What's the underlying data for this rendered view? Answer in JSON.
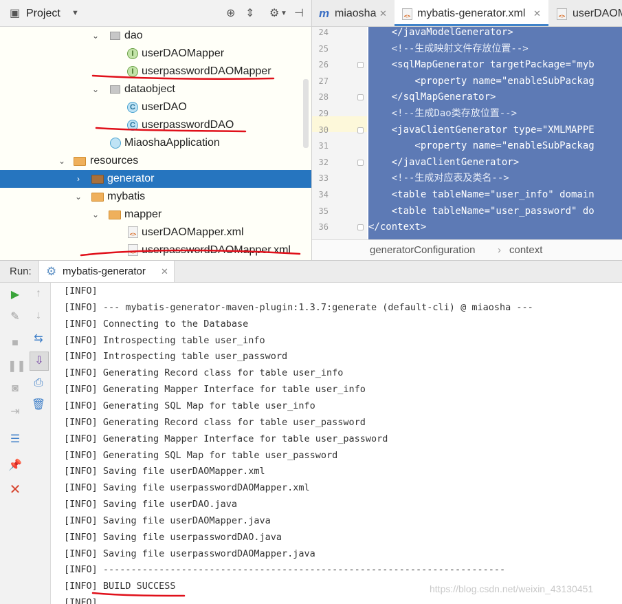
{
  "project": {
    "title": "Project",
    "tree": [
      {
        "label": "dao",
        "type": "package"
      },
      {
        "label": "userDAOMapper",
        "type": "interface"
      },
      {
        "label": "userpasswordDAOMapper",
        "type": "interface"
      },
      {
        "label": "dataobject",
        "type": "package"
      },
      {
        "label": "userDAO",
        "type": "class"
      },
      {
        "label": "userpasswordDAO",
        "type": "class"
      },
      {
        "label": "MiaoshaApplication",
        "type": "app"
      },
      {
        "label": "resources",
        "type": "folder"
      },
      {
        "label": "generator",
        "type": "folder",
        "selected": true
      },
      {
        "label": "mybatis",
        "type": "folder"
      },
      {
        "label": "mapper",
        "type": "folder"
      },
      {
        "label": "userDAOMapper.xml",
        "type": "xml"
      },
      {
        "label": "userpasswordDAOMapper.xml",
        "type": "xml"
      }
    ]
  },
  "editor": {
    "tabs": [
      {
        "label": "miaosha",
        "icon": "module-icon"
      },
      {
        "label": "mybatis-generator.xml",
        "icon": "xml-file-icon",
        "active": true
      },
      {
        "label": "userDAOM",
        "icon": "xml-file-icon"
      }
    ],
    "line_numbers": [
      "24",
      "25",
      "26",
      "27",
      "28",
      "29",
      "30",
      "31",
      "32",
      "33",
      "34",
      "35",
      "36"
    ],
    "code_lines": [
      "    </javaModelGenerator>",
      "    <!--生成映射文件存放位置-->",
      "    <sqlMapGenerator targetPackage=\"myb",
      "        <property name=\"enableSubPackag",
      "    </sqlMapGenerator>",
      "    <!--生成Dao类存放位置-->",
      "    <javaClientGenerator type=\"XMLMAPPE",
      "        <property name=\"enableSubPackag",
      "    </javaClientGenerator>",
      "    <!--生成对应表及类名-->",
      "    <table tableName=\"user_info\" domain",
      "    <table tableName=\"user_password\" do",
      "</context>"
    ],
    "breadcrumb": [
      "generatorConfiguration",
      "context"
    ]
  },
  "run": {
    "label": "Run:",
    "tab_title": "mybatis-generator",
    "console_lines": [
      "[INFO]",
      "[INFO] --- mybatis-generator-maven-plugin:1.3.7:generate (default-cli) @ miaosha ---",
      "[INFO] Connecting to the Database",
      "[INFO] Introspecting table user_info",
      "[INFO] Introspecting table user_password",
      "[INFO] Generating Record class for table user_info",
      "[INFO] Generating Mapper Interface for table user_info",
      "[INFO] Generating SQL Map for table user_info",
      "[INFO] Generating Record class for table user_password",
      "[INFO] Generating Mapper Interface for table user_password",
      "[INFO] Generating SQL Map for table user_password",
      "[INFO] Saving file userDAOMapper.xml",
      "[INFO] Saving file userpasswordDAOMapper.xml",
      "[INFO] Saving file userDAO.java",
      "[INFO] Saving file userDAOMapper.java",
      "[INFO] Saving file userpasswordDAO.java",
      "[INFO] Saving file userpasswordDAOMapper.java",
      "[INFO] ------------------------------------------------------------------------",
      "[INFO] BUILD SUCCESS",
      "[INFO]"
    ]
  },
  "watermark": "https://blog.csdn.net/weixin_43130451",
  "colors": {
    "selection": "#2675bf",
    "code_selection": "#5d7ab5",
    "annotation": "#e0101a"
  }
}
